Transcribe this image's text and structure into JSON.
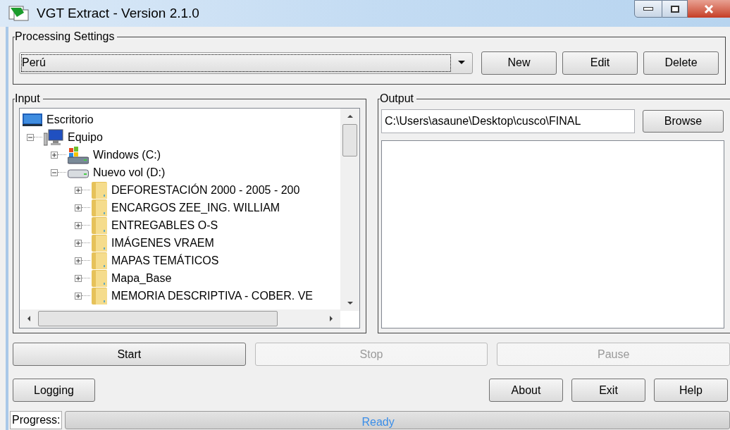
{
  "window": {
    "title": "VGT Extract - Version 2.1.0"
  },
  "processing_settings": {
    "label": "Processing Settings",
    "profile": "Perú",
    "buttons": [
      {
        "label": "New",
        "disabled": false
      },
      {
        "label": "Edit",
        "disabled": false
      },
      {
        "label": "Delete",
        "disabled": false
      }
    ]
  },
  "input": {
    "label": "Input",
    "tree": [
      {
        "label": "Escritorio",
        "kind": "desktop",
        "children": [
          {
            "label": "Equipo",
            "kind": "computer",
            "expanded": true,
            "children": [
              {
                "label": "Windows  (C:)",
                "kind": "system-drive",
                "expanded": false
              },
              {
                "label": "Nuevo vol (D:)",
                "kind": "drive",
                "expanded": true,
                "children": [
                  {
                    "label": "DEFORESTACIÓN 2000 - 2005 - 200",
                    "kind": "folder",
                    "expanded": false
                  },
                  {
                    "label": "ENCARGOS ZEE_ING. WILLIAM",
                    "kind": "folder",
                    "expanded": false
                  },
                  {
                    "label": "ENTREGABLES O-S",
                    "kind": "folder",
                    "expanded": false
                  },
                  {
                    "label": "IMÁGENES VRAEM",
                    "kind": "folder",
                    "expanded": false
                  },
                  {
                    "label": "MAPAS TEMÁTICOS",
                    "kind": "folder",
                    "expanded": false
                  },
                  {
                    "label": "Mapa_Base",
                    "kind": "folder",
                    "expanded": false
                  },
                  {
                    "label": "MEMORIA DESCRIPTIVA - COBER. VE",
                    "kind": "folder",
                    "expanded": false
                  }
                ]
              }
            ]
          }
        ]
      }
    ]
  },
  "output": {
    "label": "Output",
    "path": "C:\\Users\\asaune\\Desktop\\cusco\\FINAL",
    "browse": "Browse"
  },
  "actions": [
    {
      "label": "Start",
      "disabled": false
    },
    {
      "label": "Stop",
      "disabled": true
    },
    {
      "label": "Pause",
      "disabled": true
    }
  ],
  "bottom_left": {
    "label": "Logging"
  },
  "bottom_right": [
    {
      "label": "About"
    },
    {
      "label": "Exit"
    },
    {
      "label": "Help"
    }
  ],
  "status_bar": {
    "label": "Progress:",
    "status": "Ready",
    "level": 0
  }
}
